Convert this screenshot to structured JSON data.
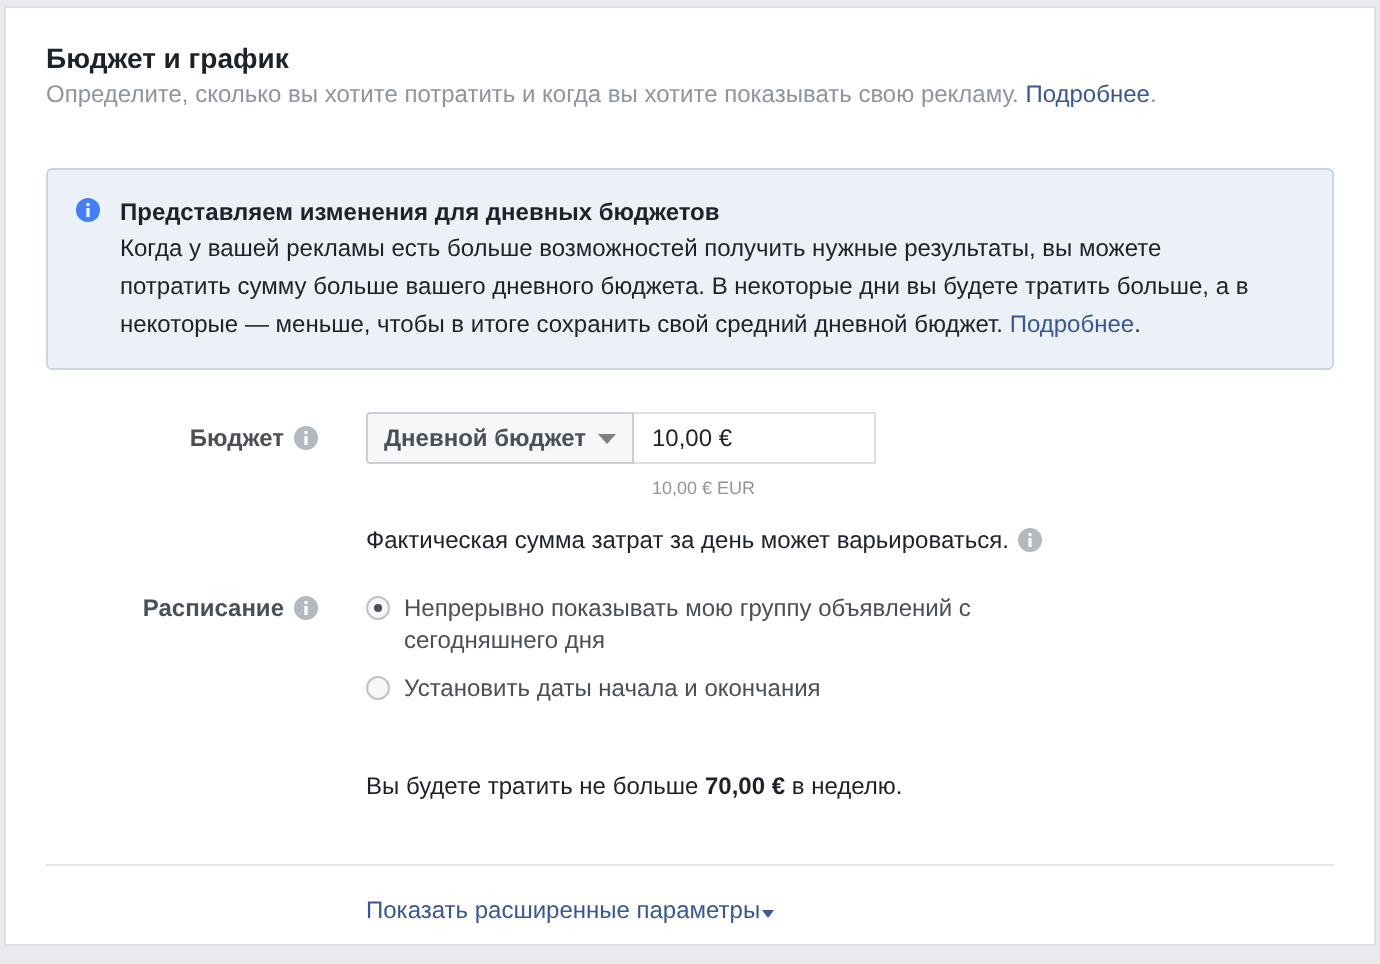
{
  "section": {
    "title": "Бюджет и график",
    "subtitle": "Определите, сколько вы хотите потратить и когда вы хотите показывать свою рекламу.",
    "subtitle_link": "Подробнее",
    "subtitle_end": "."
  },
  "notice": {
    "title": "Представляем изменения для дневных бюджетов",
    "text": "Когда у вашей рекламы есть больше возможностей получить нужные результаты, вы можете потратить сумму больше вашего дневного бюджета. В некоторые дни вы будете тратить больше, а в некоторые — меньше, чтобы в итоге сохранить свой средний дневной бюджет.",
    "link": "Подробнее",
    "end": "."
  },
  "budget": {
    "label": "Бюджет",
    "type_dropdown": "Дневной бюджет",
    "value": "10,00 €",
    "hint": "10,00 € EUR",
    "note": "Фактическая сумма затрат за день может варьироваться."
  },
  "schedule": {
    "label": "Расписание",
    "options": [
      {
        "label": "Непрерывно показывать мою группу объявлений с сегодняшнего дня",
        "selected": true
      },
      {
        "label": "Установить даты начала и окончания",
        "selected": false
      }
    ],
    "total": "Вы будете тратить не больше **70,00 €** в неделю."
  },
  "advanced_link": "Показать расширенные параметры"
}
